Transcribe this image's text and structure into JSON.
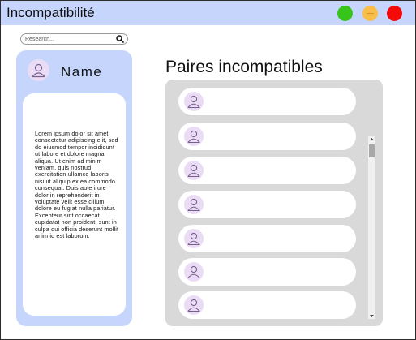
{
  "window": {
    "title": "Incompatibilité"
  },
  "colors": {
    "titlebar": "#c6d5fb",
    "panel": "#c6d5fb",
    "list_bg": "#d9d9d9",
    "avatar": "#eadcf5",
    "btn_green": "#37c51b",
    "btn_orange": "#f9bd4a",
    "btn_red": "#f50a0a"
  },
  "search": {
    "placeholder": "Research..."
  },
  "profile": {
    "name": "Name",
    "bio": "Lorem ipsum dolor sit amet, consectetur adipiscing elit, sed do eiusmod tempor incididunt ut labore et dolore magna aliqua. Ut enim ad minim veniam, quis nostrud exercitation ullamco laboris nisi ut aliquip ex ea commodo consequat. Duis aute irure dolor in reprehenderit in voluptate velit esse cillum dolore eu fugiat nulla pariatur. Excepteur sint occaecat cupidatat non proident, sunt in culpa qui officia deserunt mollit anim id est laborum."
  },
  "incompatible_pairs": {
    "title": "Paires incompatibles",
    "items": [
      {
        "icon": "user-icon"
      },
      {
        "icon": "user-icon"
      },
      {
        "icon": "user-icon"
      },
      {
        "icon": "user-icon"
      },
      {
        "icon": "user-icon"
      },
      {
        "icon": "user-icon"
      },
      {
        "icon": "user-icon"
      }
    ]
  }
}
